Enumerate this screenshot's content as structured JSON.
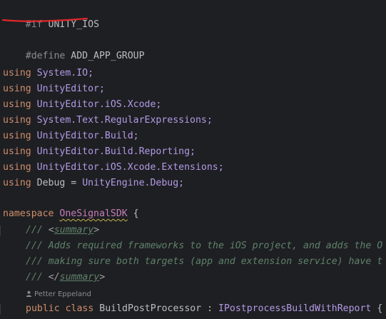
{
  "code": {
    "if_keyword": "#if",
    "if_symbol": "UNITY_IOS",
    "define_keyword": "#define",
    "define_symbol": "ADD_APP_GROUP",
    "using_kw": "using",
    "usings": [
      "System.IO;",
      "UnityEditor;",
      "UnityEditor.iOS.Xcode;",
      "System.Text.RegularExpressions;",
      "UnityEditor.Build;",
      "UnityEditor.Build.Reporting;",
      "UnityEditor.iOS.Xcode.Extensions;"
    ],
    "using_alias": {
      "name": "Debug",
      "eq": " = ",
      "target": "UnityEngine.Debug;"
    },
    "namespace_kw": "namespace",
    "namespace_name": "OneSignalSDK",
    "namespace_open": " {",
    "doc": {
      "prefix": "/// ",
      "summary_open_lt": "<",
      "summary_tag": "summary",
      "summary_open_gt": ">",
      "line1": "/// Adds required frameworks to the iOS project, and adds the O",
      "line2": "/// making sure both targets (app and extension service) have t",
      "summary_close_lt": "</",
      "summary_close_gt": ">"
    },
    "author_inlay": "Petter Eppeland",
    "class_decl": {
      "public": "public",
      "class": "class",
      "name": "BuildPostProcessor",
      "colon": " : ",
      "base": "IPostprocessBuildWithReport",
      "brace": " {"
    }
  },
  "colors": {
    "background": "#1e1f22",
    "keyword": "#cf8e6d",
    "comment": "#5f826b",
    "highlight_underline": "#e0272b"
  }
}
